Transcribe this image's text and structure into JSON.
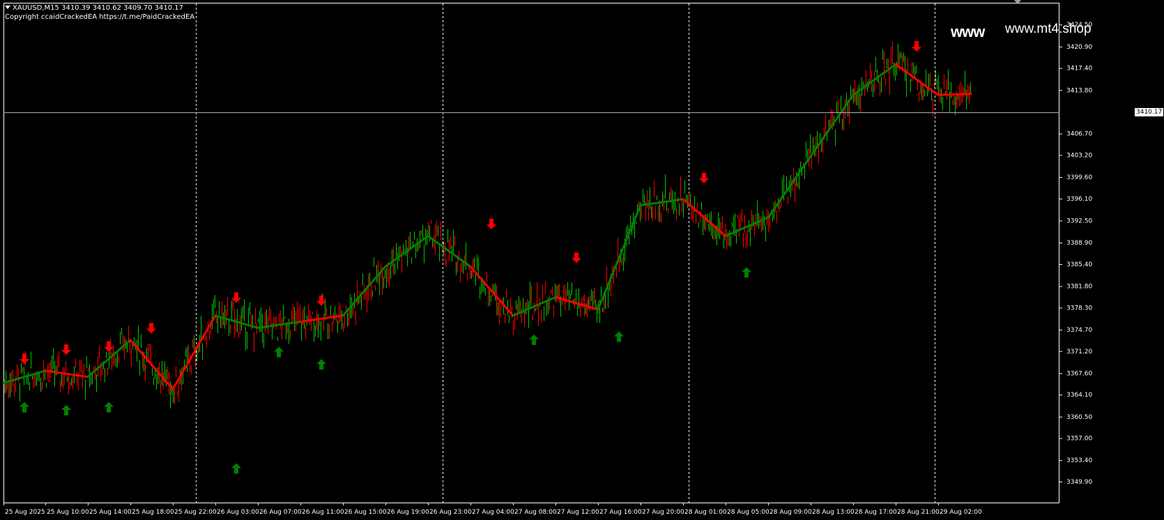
{
  "header": {
    "symbol_line": "XAUUSD,M15  3410.39 3410.62 3409.70 3410.17",
    "copyright_line": "Copyright ccaidCrackedEA https://t.me/PaidCrackedEA"
  },
  "watermark": "www.mt4.shop",
  "www_overlay": "www",
  "current_price_label": "3410.17",
  "colors": {
    "background": "#000000",
    "bull_candle": "#00c800",
    "bear_candle": "#ff0000",
    "up_line": "#008000",
    "down_line": "#ff0000",
    "buy_arrow": "#008000",
    "sell_arrow": "#ff0000",
    "grid": "#ffffff",
    "text": "#ffffff"
  },
  "chart_data": {
    "type": "candlestick",
    "symbol": "XAUUSD",
    "timeframe": "M15",
    "last_ohlc": {
      "open": 3410.39,
      "high": 3410.62,
      "low": 3409.7,
      "close": 3410.17
    },
    "current_price": 3410.17,
    "ylim": [
      3349.9,
      3426.0
    ],
    "y_ticks": [
      "3424.50",
      "3420.90",
      "3417.40",
      "3413.80",
      "3406.70",
      "3403.20",
      "3399.60",
      "3396.10",
      "3392.50",
      "3388.90",
      "3385.40",
      "3381.80",
      "3378.30",
      "3374.70",
      "3371.20",
      "3367.60",
      "3364.10",
      "3360.50",
      "3357.00",
      "3353.40",
      "3349.90"
    ],
    "x_ticks": [
      "25 Aug 2025",
      "25 Aug 10:00",
      "25 Aug 14:00",
      "25 Aug 18:00",
      "25 Aug 22:00",
      "26 Aug 03:00",
      "26 Aug 07:00",
      "26 Aug 11:00",
      "26 Aug 15:00",
      "26 Aug 19:00",
      "26 Aug 23:00",
      "27 Aug 04:00",
      "27 Aug 08:00",
      "27 Aug 12:00",
      "27 Aug 16:00",
      "27 Aug 20:00",
      "28 Aug 01:00",
      "28 Aug 05:00",
      "28 Aug 09:00",
      "28 Aug 13:00",
      "28 Aug 17:00",
      "28 Aug 21:00",
      "29 Aug 02:00"
    ],
    "grid": "vertical period separators (dashed)",
    "indicator_line": [
      {
        "label": "25 Aug 2025",
        "value": 3366.0,
        "trend": "up"
      },
      {
        "label": "25 Aug 10:00",
        "value": 3368.0,
        "trend": "down"
      },
      {
        "label": "25 Aug 14:00",
        "value": 3367.0,
        "trend": "up"
      },
      {
        "label": "25 Aug 18:00",
        "value": 3373.0,
        "trend": "down"
      },
      {
        "label": "25 Aug 22:00",
        "value": 3365.0,
        "trend": "down"
      },
      {
        "label": "26 Aug 03:00",
        "value": 3377.0,
        "trend": "up"
      },
      {
        "label": "26 Aug 07:00",
        "value": 3375.0,
        "trend": "up"
      },
      {
        "label": "26 Aug 11:00",
        "value": 3376.0,
        "trend": "down"
      },
      {
        "label": "26 Aug 15:00",
        "value": 3377.0,
        "trend": "up"
      },
      {
        "label": "26 Aug 19:00",
        "value": 3385.0,
        "trend": "up"
      },
      {
        "label": "26 Aug 23:00",
        "value": 3390.0,
        "trend": "up"
      },
      {
        "label": "27 Aug 04:00",
        "value": 3385.0,
        "trend": "down"
      },
      {
        "label": "27 Aug 08:00",
        "value": 3377.0,
        "trend": "up"
      },
      {
        "label": "27 Aug 12:00",
        "value": 3380.0,
        "trend": "down"
      },
      {
        "label": "27 Aug 16:00",
        "value": 3378.0,
        "trend": "up"
      },
      {
        "label": "27 Aug 20:00",
        "value": 3395.0,
        "trend": "up"
      },
      {
        "label": "28 Aug 01:00",
        "value": 3396.0,
        "trend": "down"
      },
      {
        "label": "28 Aug 05:00",
        "value": 3390.0,
        "trend": "up"
      },
      {
        "label": "28 Aug 09:00",
        "value": 3393.0,
        "trend": "up"
      },
      {
        "label": "28 Aug 13:00",
        "value": 3403.0,
        "trend": "up"
      },
      {
        "label": "28 Aug 17:00",
        "value": 3413.0,
        "trend": "up"
      },
      {
        "label": "28 Aug 21:00",
        "value": 3418.0,
        "trend": "down"
      },
      {
        "label": "29 Aug 02:00",
        "value": 3413.0,
        "trend": "down"
      }
    ],
    "signals": [
      {
        "type": "sell",
        "label": "25 Aug 2025",
        "price": 3370.0
      },
      {
        "type": "buy",
        "label": "25 Aug 2025",
        "price": 3362.0
      },
      {
        "type": "sell",
        "label": "25 Aug 10:00",
        "price": 3371.5
      },
      {
        "type": "buy",
        "label": "25 Aug 10:00",
        "price": 3361.5
      },
      {
        "type": "sell",
        "label": "25 Aug 14:00",
        "price": 3372.0
      },
      {
        "type": "buy",
        "label": "25 Aug 14:00",
        "price": 3362.0
      },
      {
        "type": "sell",
        "label": "25 Aug 18:00",
        "price": 3375.0
      },
      {
        "type": "buy",
        "label": "26 Aug 03:00",
        "price": 3352.0
      },
      {
        "type": "sell",
        "label": "26 Aug 03:00",
        "price": 3380.0
      },
      {
        "type": "buy",
        "label": "26 Aug 07:00",
        "price": 3371.0
      },
      {
        "type": "sell",
        "label": "26 Aug 11:00",
        "price": 3379.5
      },
      {
        "type": "buy",
        "label": "26 Aug 11:00",
        "price": 3369.0
      },
      {
        "type": "sell",
        "label": "27 Aug 04:00",
        "price": 3392.0
      },
      {
        "type": "buy",
        "label": "27 Aug 08:00",
        "price": 3373.0
      },
      {
        "type": "sell",
        "label": "27 Aug 12:00",
        "price": 3386.5
      },
      {
        "type": "buy",
        "label": "27 Aug 16:00",
        "price": 3373.5
      },
      {
        "type": "sell",
        "label": "28 Aug 01:00",
        "price": 3399.5
      },
      {
        "type": "buy",
        "label": "28 Aug 05:00",
        "price": 3384.0
      },
      {
        "type": "sell",
        "label": "28 Aug 21:00",
        "price": 3421.0
      }
    ]
  }
}
